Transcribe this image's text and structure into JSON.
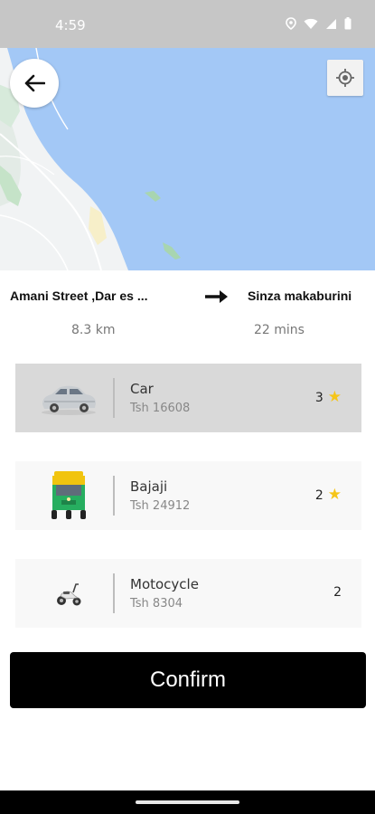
{
  "status_bar": {
    "time": "4:59"
  },
  "route": {
    "from": "Amani Street ,Dar es ...",
    "to": "Sinza makaburini",
    "distance": "8.3 km",
    "duration": "22 mins"
  },
  "options": [
    {
      "name": "Car",
      "price": "Tsh 16608",
      "rating": "3",
      "has_star": true,
      "selected": true,
      "icon": "car-icon"
    },
    {
      "name": "Bajaji",
      "price": "Tsh 24912",
      "rating": "2",
      "has_star": true,
      "selected": false,
      "icon": "bajaji-icon"
    },
    {
      "name": "Motocycle",
      "price": "Tsh 8304",
      "rating": "2",
      "has_star": false,
      "selected": false,
      "icon": "motorcycle-icon"
    }
  ],
  "confirm_label": "Confirm",
  "colors": {
    "map_water": "#a3c8f6",
    "map_land": "#f1f3f4",
    "star": "#f5c518",
    "selected_row": "#d9d9d9",
    "button": "#000000"
  }
}
